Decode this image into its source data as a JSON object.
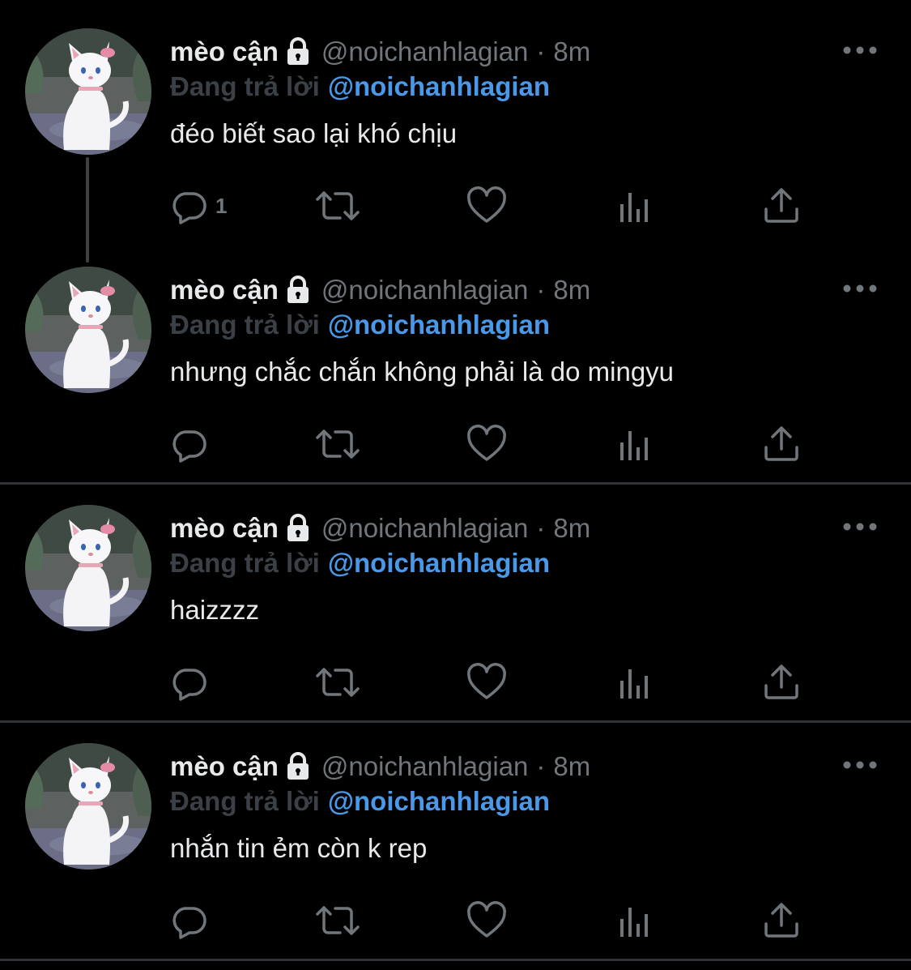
{
  "colors": {
    "background": "#000000",
    "text_primary": "#e7e9ea",
    "text_secondary": "#71767b",
    "reply_prefix": "#3b4046",
    "mention_blue": "#4a99e9",
    "divider": "#2f3336"
  },
  "tweets": [
    {
      "display_name": "mèo cận",
      "lock_icon": "lock-icon",
      "handle": "@noichanhlagian",
      "separator": "·",
      "time": "8m",
      "reply_prefix": "Đang trả lời",
      "reply_mention": "@noichanhlagian",
      "text": "đéo biết sao lại khó chịu",
      "reply_count": "1"
    },
    {
      "display_name": "mèo cận",
      "lock_icon": "lock-icon",
      "handle": "@noichanhlagian",
      "separator": "·",
      "time": "8m",
      "reply_prefix": "Đang trả lời",
      "reply_mention": "@noichanhlagian",
      "text": "nhưng chắc chắn không phải là do mingyu",
      "reply_count": ""
    },
    {
      "display_name": "mèo cận",
      "lock_icon": "lock-icon",
      "handle": "@noichanhlagian",
      "separator": "·",
      "time": "8m",
      "reply_prefix": "Đang trả lời",
      "reply_mention": "@noichanhlagian",
      "text": "haizzzz",
      "reply_count": ""
    },
    {
      "display_name": "mèo cận",
      "lock_icon": "lock-icon",
      "handle": "@noichanhlagian",
      "separator": "·",
      "time": "8m",
      "reply_prefix": "Đang trả lời",
      "reply_mention": "@noichanhlagian",
      "text": "nhắn tin ẻm còn k rep",
      "reply_count": ""
    }
  ],
  "icons": {
    "avatar": "white-cat-avatar",
    "more": "more-options-icon",
    "reply": "reply-icon",
    "retweet": "retweet-icon",
    "like": "like-icon",
    "views": "views-icon",
    "share": "share-icon"
  }
}
